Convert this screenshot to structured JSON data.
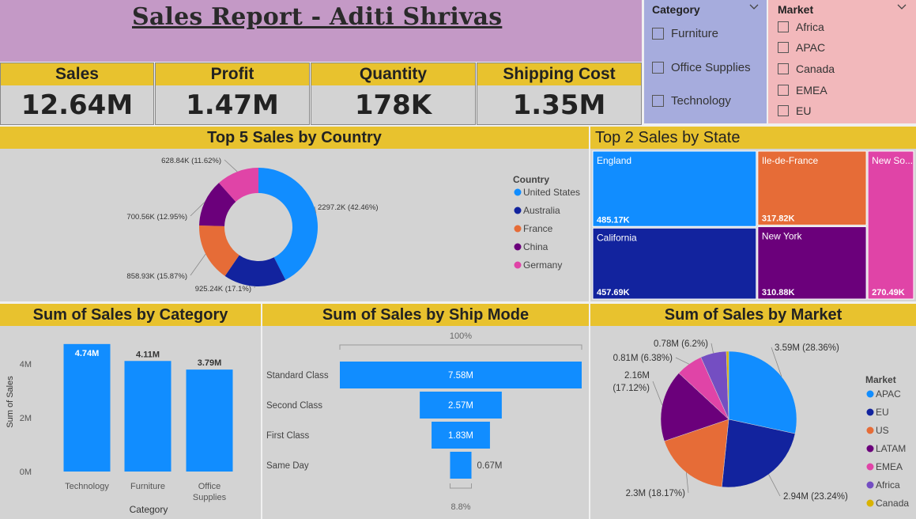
{
  "report": {
    "title": "Sales Report - Aditi Shrivas"
  },
  "kpis": [
    {
      "label": "Sales",
      "value": "12.64M"
    },
    {
      "label": "Profit",
      "value": "1.47M"
    },
    {
      "label": "Quantity",
      "value": "178K"
    },
    {
      "label": "Shipping Cost",
      "value": "1.35M"
    }
  ],
  "slicers": {
    "category": {
      "title": "Category",
      "options": [
        "Furniture",
        "Office Supplies",
        "Technology"
      ]
    },
    "market": {
      "title": "Market",
      "options": [
        "Africa",
        "APAC",
        "Canada",
        "EMEA",
        "EU"
      ]
    }
  },
  "colors": {
    "blue": "#118dff",
    "navy": "#12239e",
    "orange": "#e66c37",
    "purple": "#6b007b",
    "pink": "#e044a7",
    "violet": "#744ec2",
    "gold": "#d9b300",
    "header": "#e8c22e"
  },
  "chart_data": [
    {
      "type": "pie",
      "title": "Top 5 Sales by Country",
      "legend_title": "Country",
      "legend_placement": "right",
      "categories": [
        "United States",
        "Australia",
        "France",
        "China",
        "Germany"
      ],
      "values": [
        2297.2,
        925.24,
        858.93,
        700.56,
        628.84
      ],
      "data_labels": [
        "2297.2K (42.46%)",
        "925.24K (17.1%)",
        "858.93K (15.87%)",
        "700.56K (12.95%)",
        "628.84K (11.62%)"
      ],
      "colors": [
        "#118dff",
        "#12239e",
        "#e66c37",
        "#6b007b",
        "#e044a7"
      ]
    },
    {
      "type": "treemap",
      "title": "Top 2 Sales by State",
      "groups": [
        {
          "items": [
            {
              "name": "England",
              "label": "485.17K",
              "value": 485.17,
              "color": "#118dff"
            },
            {
              "name": "California",
              "label": "457.69K",
              "value": 457.69,
              "color": "#12239e"
            }
          ]
        },
        {
          "items": [
            {
              "name": "Ile-de-France",
              "label": "317.82K",
              "value": 317.82,
              "color": "#e66c37"
            },
            {
              "name": "New York",
              "label": "310.88K",
              "value": 310.88,
              "color": "#6b007b"
            }
          ]
        },
        {
          "items": [
            {
              "name": "New So...",
              "label": "270.49K",
              "value": 270.49,
              "color": "#e044a7"
            }
          ]
        }
      ]
    },
    {
      "type": "bar",
      "title": "Sum of Sales by Category",
      "categories": [
        "Technology",
        "Furniture",
        "Office Supplies"
      ],
      "category_labels": [
        [
          "Technology"
        ],
        [
          "Furniture"
        ],
        [
          "Office",
          "Supplies"
        ]
      ],
      "values": [
        4.74,
        4.11,
        3.79
      ],
      "data_labels": [
        "4.74M",
        "4.11M",
        "3.79M"
      ],
      "xlabel": "Category",
      "ylabel": "Sum of Sales",
      "ylim": [
        0,
        5
      ],
      "yticks": [
        0,
        2,
        4
      ],
      "ytick_labels": [
        "0M",
        "2M",
        "4M"
      ],
      "color": "#118dff"
    },
    {
      "type": "funnel",
      "title": "Sum of Sales by Ship Mode",
      "categories": [
        "Standard Class",
        "Second Class",
        "First Class",
        "Same Day"
      ],
      "values": [
        7.58,
        2.57,
        1.83,
        0.67
      ],
      "data_labels": [
        "7.58M",
        "2.57M",
        "1.83M",
        "0.67M"
      ],
      "top_percent": "100%",
      "bottom_percent": "8.8%",
      "color": "#118dff"
    },
    {
      "type": "pie",
      "title": "Sum of Sales by Market",
      "legend_title": "Market",
      "legend_placement": "right",
      "categories": [
        "APAC",
        "EU",
        "US",
        "LATAM",
        "EMEA",
        "Africa",
        "Canada"
      ],
      "values": [
        3.59,
        2.94,
        2.3,
        2.16,
        0.81,
        0.78,
        0.07
      ],
      "data_labels": [
        "3.59M (28.36%)",
        "2.94M (23.24%)",
        "2.3M (18.17%)",
        "2.16M (17.12%)",
        "0.81M (6.38%)",
        "0.78M (6.2%)",
        ""
      ],
      "colors": [
        "#118dff",
        "#12239e",
        "#e66c37",
        "#6b007b",
        "#e044a7",
        "#744ec2",
        "#d9b300"
      ]
    }
  ]
}
